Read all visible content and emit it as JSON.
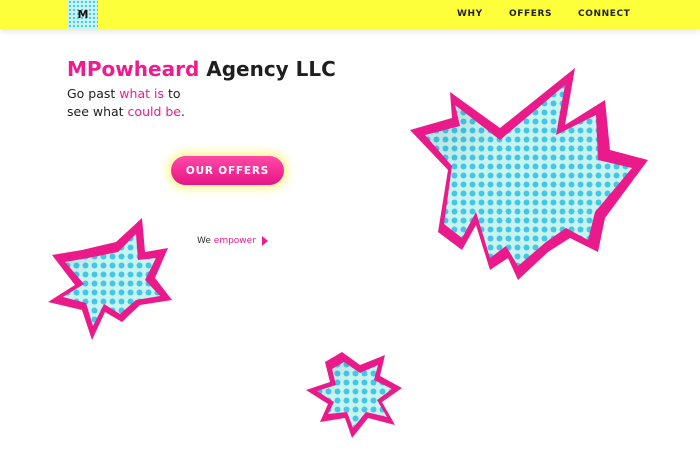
{
  "header": {
    "logo_letter": "M",
    "nav": [
      {
        "label": "WHY"
      },
      {
        "label": "OFFERS"
      },
      {
        "label": "CONNECT"
      }
    ]
  },
  "hero": {
    "title_brand": "MPowheard",
    "title_rest": " Agency LLC",
    "tagline": {
      "part1": "Go past ",
      "highlight1": "what is",
      "part2": " to see what ",
      "highlight2": "could be",
      "end": "."
    },
    "cta_label": "OUR OFFERS",
    "link_prefix": "We ",
    "link_highlight": "empower"
  },
  "colors": {
    "header_bg": "#fcff3a",
    "accent_pink": "#ee1c8f",
    "dot_blue": "#41c8e9",
    "burst_fill": "#c9f3ef"
  },
  "decorations": {
    "burst_icon": "comic-burst-icon"
  }
}
